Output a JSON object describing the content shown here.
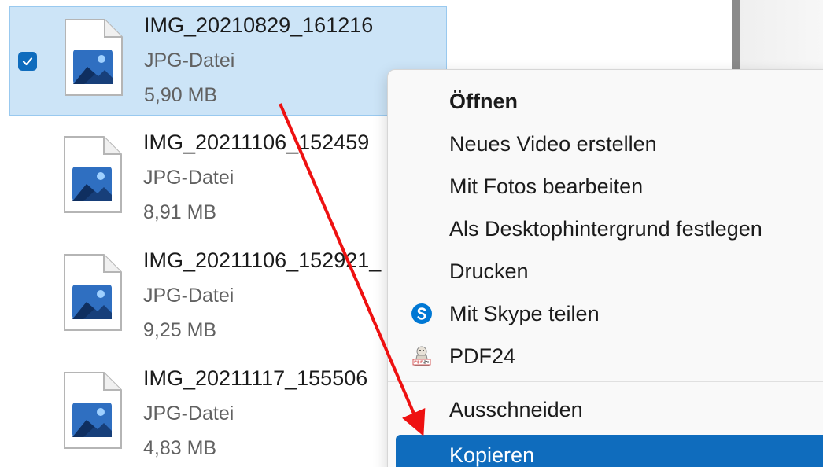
{
  "files": [
    {
      "name": "IMG_20210829_161216",
      "type": "JPG-Datei",
      "size": "5,90 MB",
      "selected": true
    },
    {
      "name": "IMG_20211106_152459",
      "type": "JPG-Datei",
      "size": "8,91 MB",
      "selected": false
    },
    {
      "name": "IMG_20211106_152921_",
      "type": "JPG-Datei",
      "size": "9,25 MB",
      "selected": false
    },
    {
      "name": "IMG_20211117_155506",
      "type": "JPG-Datei",
      "size": "4,83 MB",
      "selected": false
    }
  ],
  "context_menu": {
    "items": [
      {
        "label": "Öffnen",
        "icon": "",
        "bold": true
      },
      {
        "label": "Neues Video erstellen",
        "icon": ""
      },
      {
        "label": "Mit Fotos bearbeiten",
        "icon": ""
      },
      {
        "label": "Als Desktophintergrund festlegen",
        "icon": ""
      },
      {
        "label": "Drucken",
        "icon": ""
      },
      {
        "label": "Mit Skype teilen",
        "icon": "skype-icon"
      },
      {
        "label": "PDF24",
        "icon": "pdf24-icon"
      },
      {
        "label": "Ausschneiden",
        "icon": ""
      },
      {
        "label": "Kopieren",
        "icon": "",
        "highlighted": true
      }
    ]
  },
  "colors": {
    "selection_bg": "#cce4f7",
    "accent": "#0f6cbd",
    "arrow": "#ee1111",
    "skype": "#0078d4"
  }
}
